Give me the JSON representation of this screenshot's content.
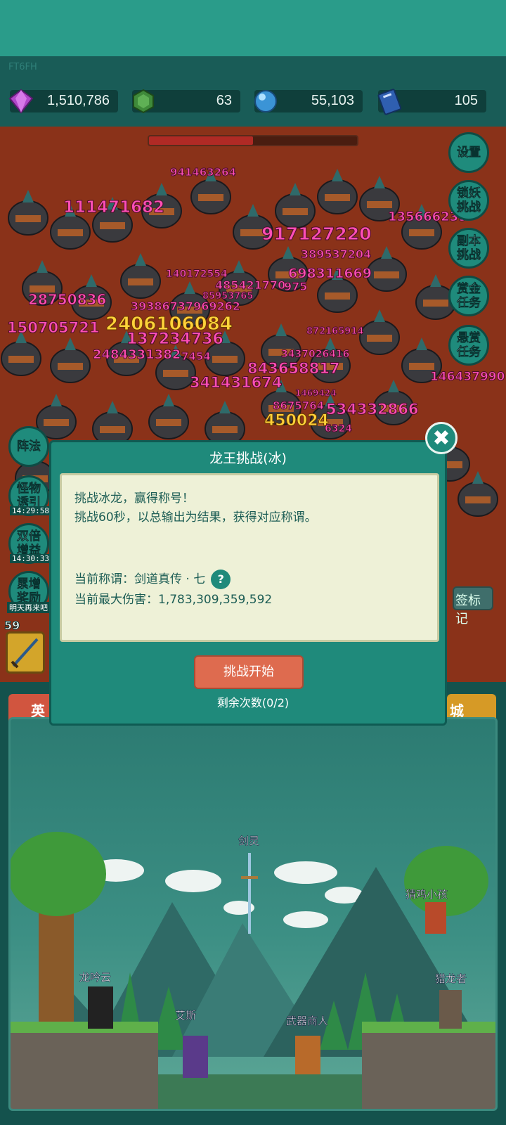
{
  "header": {
    "build_id": "FT6FH"
  },
  "resources": [
    {
      "name": "gem",
      "icon": "purple-gem-icon",
      "value": "1,510,786",
      "color": "#9b3fb5"
    },
    {
      "name": "jade",
      "icon": "green-jade-icon",
      "value": "63",
      "color": "#3f8a3a"
    },
    {
      "name": "orb",
      "icon": "blue-orb-icon",
      "value": "55,103",
      "color": "#4aa6e0"
    },
    {
      "name": "book",
      "icon": "blue-book-icon",
      "value": "105",
      "color": "#2f5fb0"
    }
  ],
  "battle": {
    "boss_hp_fraction": 0.5,
    "damage_numbers": [
      "941463264",
      "111471682",
      "917127220",
      "135666239",
      "389537204",
      "698311669",
      "28750836",
      "485421770",
      "975",
      "150705721",
      "2406106084",
      "137234736",
      "2484331382",
      "7454",
      "843658817",
      "341431674",
      "534332866",
      "450024",
      "8675764",
      "146437990",
      "6324",
      "872165914",
      "1469424",
      "85953765",
      "140172554",
      "3437026416",
      "39386737969262"
    ]
  },
  "right_menu": [
    {
      "label": "设置"
    },
    {
      "label": "锁妖挑战"
    },
    {
      "label": "副本挑战"
    },
    {
      "label": "赏金任务"
    },
    {
      "label": "悬赏任务"
    }
  ],
  "left_menu": [
    {
      "label": "阵法",
      "timer": ""
    },
    {
      "label": "怪物诱引",
      "timer": "14:29:58"
    },
    {
      "label": "双倍增益",
      "timer": "14:30:33"
    },
    {
      "label": "累增奖励",
      "timer": "明天再来吧"
    }
  ],
  "lower": {
    "skill_level": "59",
    "tab_left": "英",
    "tab_right": "城",
    "mark_button": "签标记"
  },
  "scene": {
    "npcs": [
      "剑灵",
      "猜鸡小孩",
      "龙吟云",
      "猎龙者",
      "艾斯",
      "武器商人"
    ]
  },
  "modal": {
    "title": "龙王挑战(冰)",
    "line1": "挑战冰龙，赢得称号！",
    "line2": "挑战60秒，以总输出为结果，获得对应称谓。",
    "title_label": "当前称谓：剑道真传 · 七",
    "max_damage_label": "当前最大伤害：1,783,309,359,592",
    "help_icon": "?",
    "start_button": "挑战开始",
    "remaining": "剩余次数(0/2)",
    "close_icon": "✖"
  }
}
